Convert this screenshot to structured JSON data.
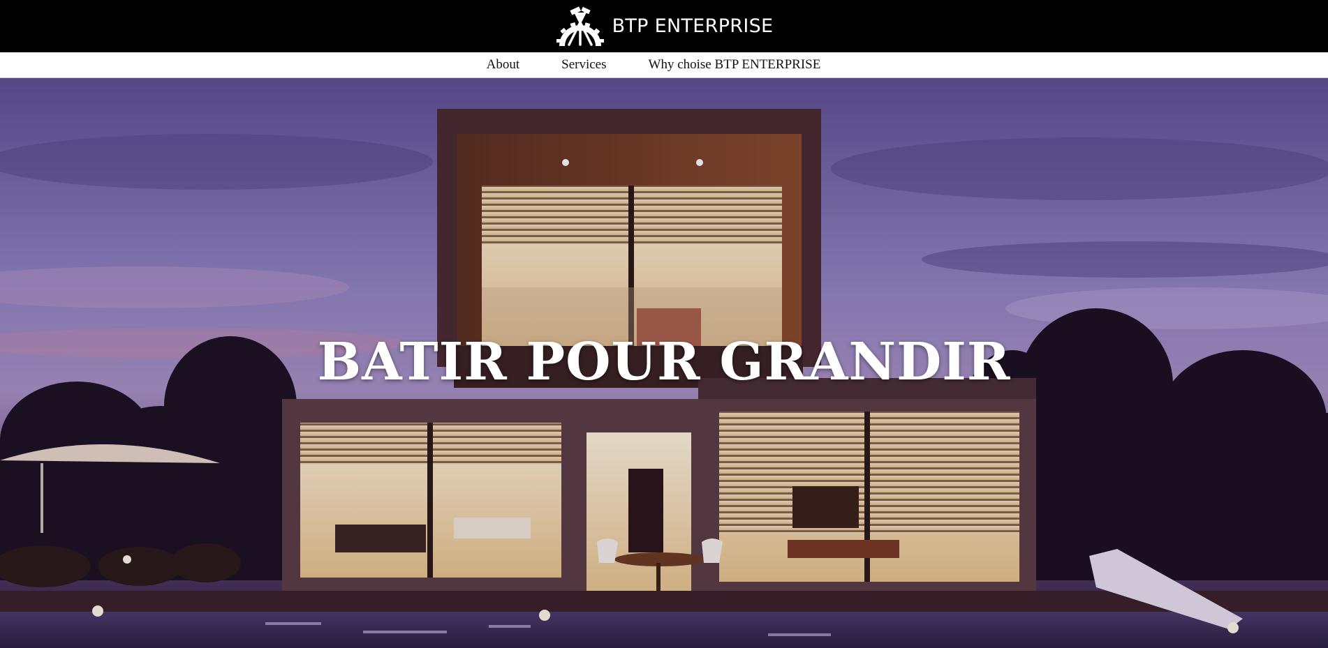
{
  "header": {
    "brand_name": "BTP ENTERPRISE",
    "logo_icon": "construction-tools-logo"
  },
  "nav": {
    "items": [
      {
        "label": "About"
      },
      {
        "label": "Services"
      },
      {
        "label": "Why choise BTP ENTERPRISE"
      }
    ]
  },
  "hero": {
    "title": "BATIR POUR GRANDIR",
    "background": "modern-house-at-dusk-photo"
  },
  "colors": {
    "topbar": "#000000",
    "navbar": "#ffffff",
    "sky": "#6f5f9e",
    "title": "#ffffff"
  }
}
